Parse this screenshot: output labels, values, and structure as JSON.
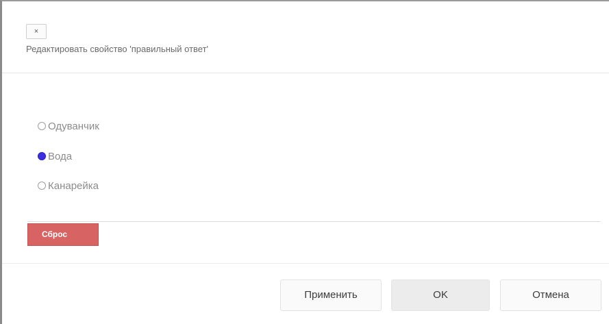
{
  "dialog": {
    "close_label": "×",
    "title": "Редактировать свойство 'правильный ответ'"
  },
  "options": [
    {
      "label": "Одуванчик",
      "checked": false
    },
    {
      "label": "Вода",
      "checked": true
    },
    {
      "label": "Канарейка",
      "checked": false
    }
  ],
  "reset_label": "Сброс",
  "footer": {
    "apply_label": "Применить",
    "ok_label": "OK",
    "cancel_label": "Отмена"
  },
  "colors": {
    "selected_radio": "#3b2fe0",
    "reset_button": "#d76363"
  }
}
